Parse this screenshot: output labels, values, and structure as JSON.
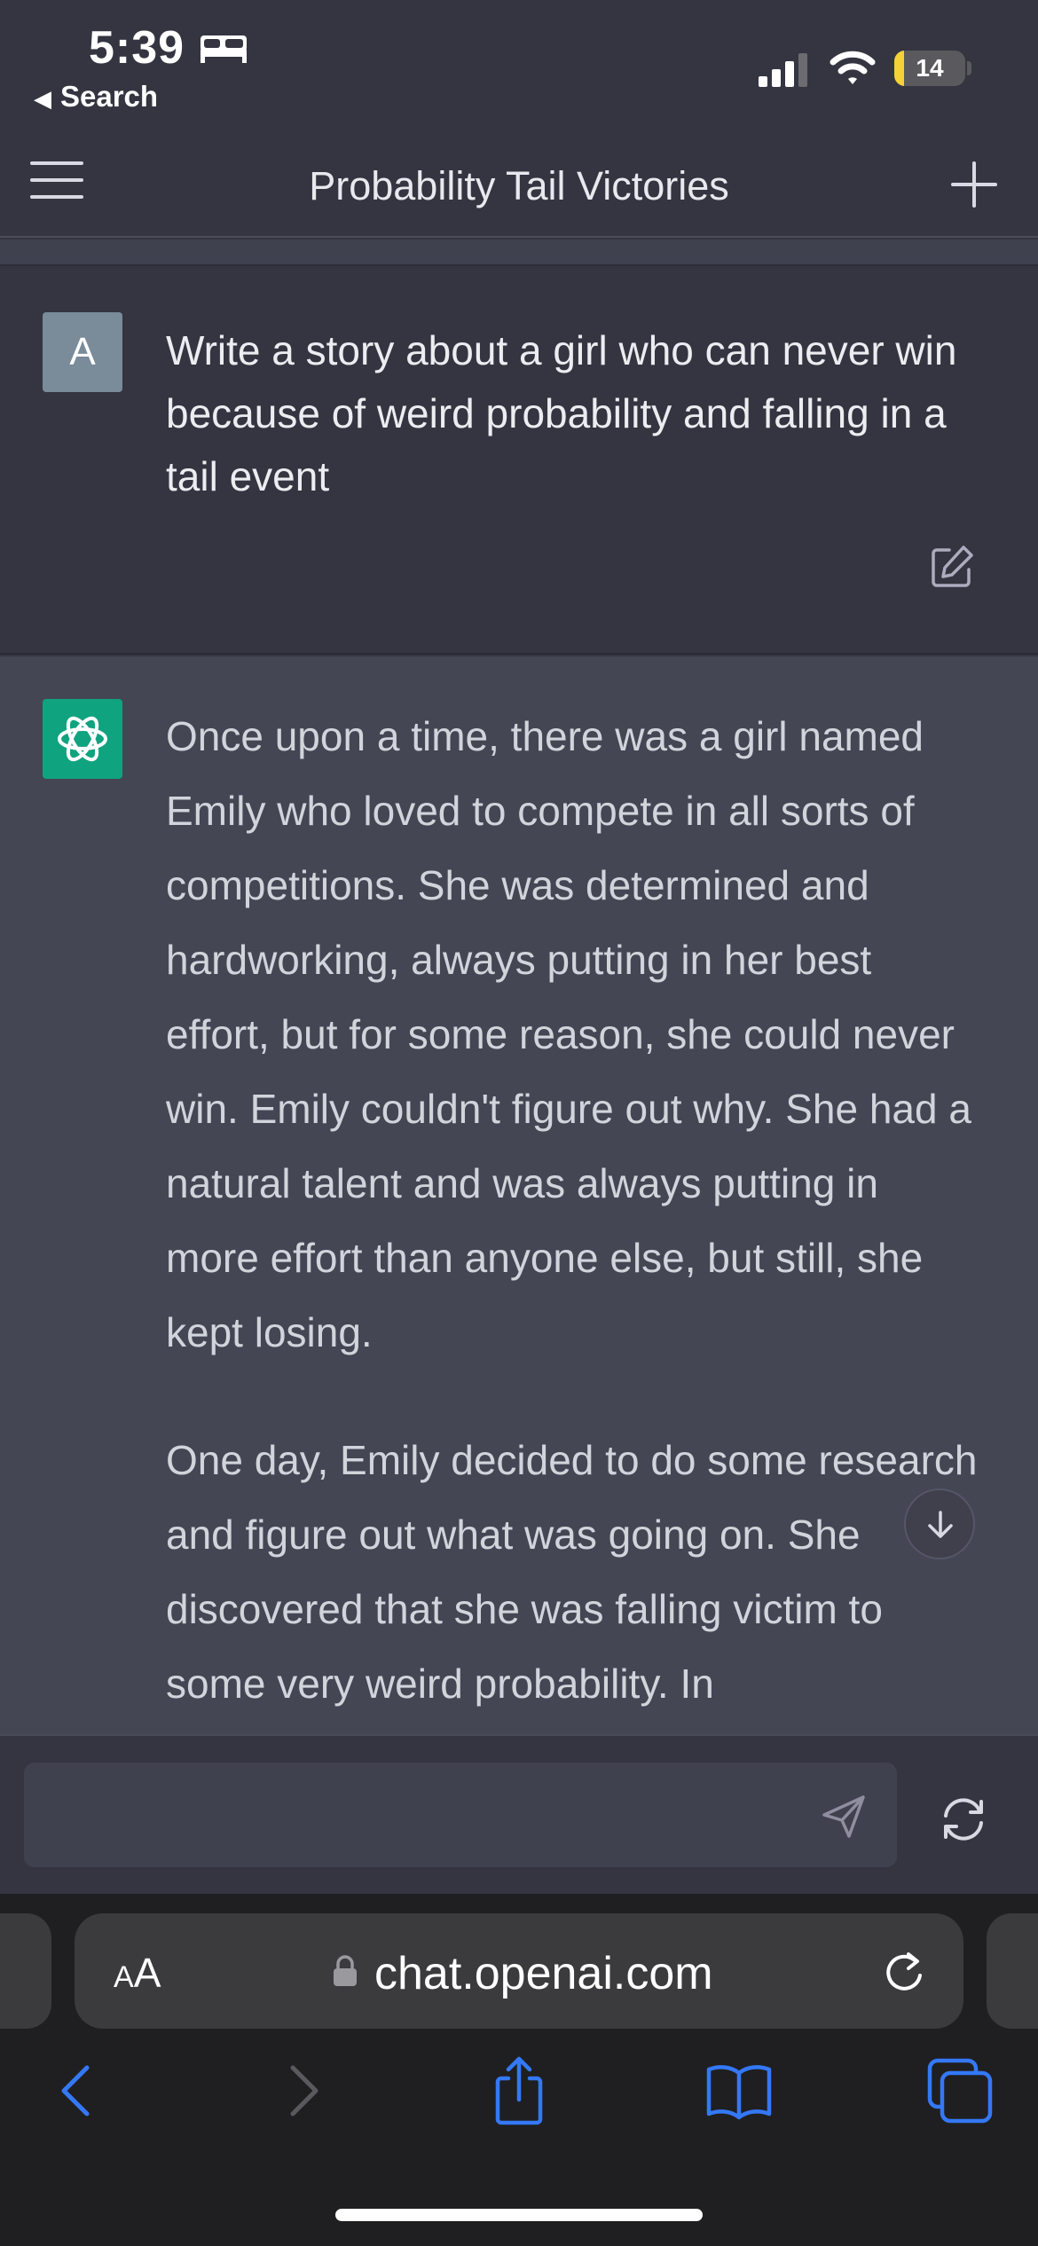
{
  "status_bar": {
    "time": "5:39",
    "back_label": "Search",
    "battery_level": "14",
    "battery_fraction": 0.14,
    "icons": [
      "bed-icon",
      "signal-icon",
      "wifi-icon",
      "battery-icon"
    ]
  },
  "header": {
    "title": "Probability Tail Victories",
    "menu_icon": "hamburger-menu-icon",
    "new_chat_icon": "plus-icon"
  },
  "user_message": {
    "avatar_letter": "A",
    "text": "Write a story about a girl who can never win because of weird probability and falling in a tail event",
    "edit_icon": "edit-icon"
  },
  "assistant_message": {
    "avatar_icon": "openai-logo-icon",
    "paragraphs": [
      "Once upon a time, there was a girl named Emily who loved to compete in all sorts of competitions. She was determined and hardworking, always putting in her best effort, but for some reason, she could never win. Emily couldn't figure out why. She had a natural talent and was always putting in more effort than anyone else, but still, she kept losing.",
      "One day, Emily decided to do some research and figure out what was going on. She discovered that she was falling victim to some very weird probability. In"
    ]
  },
  "composer": {
    "value": "",
    "placeholder": "",
    "send_icon": "send-icon",
    "regenerate_icon": "regenerate-icon"
  },
  "safari": {
    "aa_label_big": "A",
    "aa_label_small": "A",
    "url": "chat.openai.com",
    "toolbar_icons": [
      "back-icon",
      "forward-icon",
      "share-icon",
      "bookmarks-icon",
      "tabs-icon"
    ]
  },
  "colors": {
    "background": "#343541",
    "assistant_bg": "#444654",
    "openai_green": "#10a37f",
    "safari_blue": "#3478f6",
    "battery_yellow": "#f5d235"
  }
}
